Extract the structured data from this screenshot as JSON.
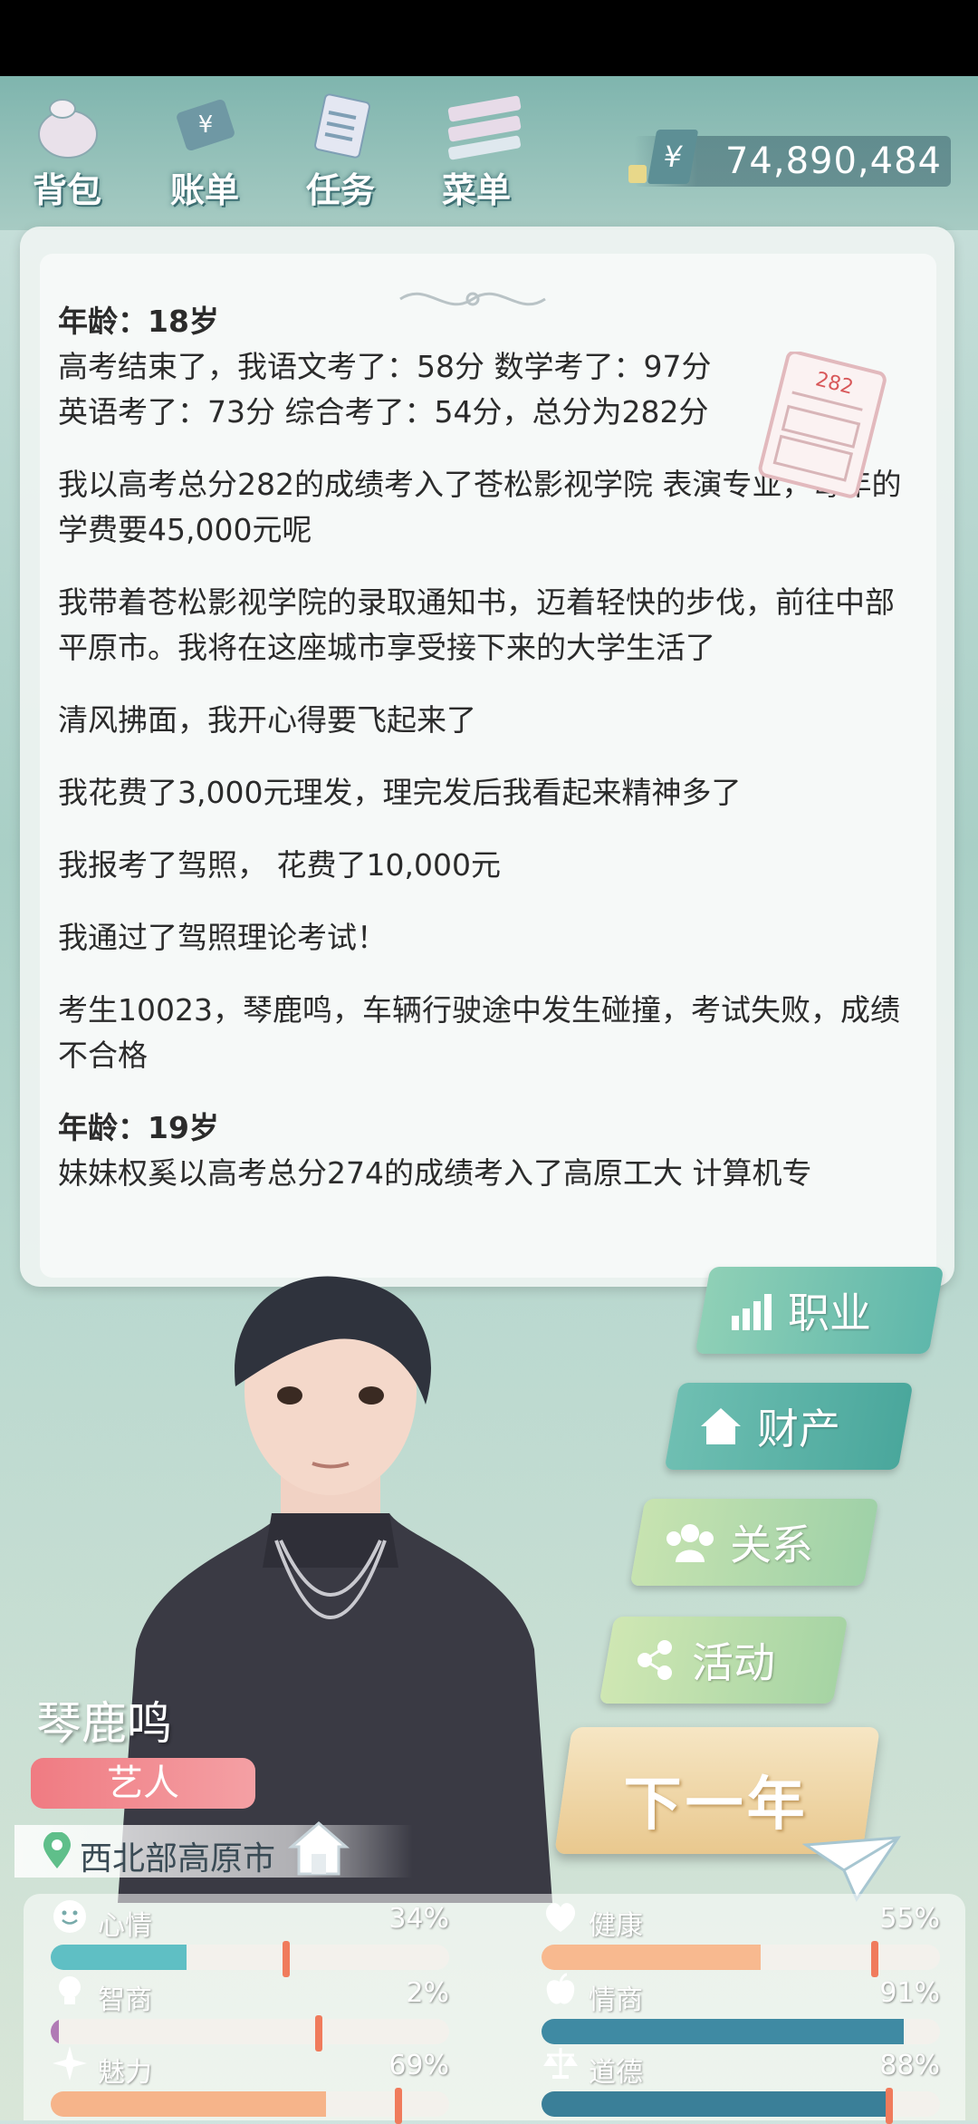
{
  "nav": {
    "items": [
      {
        "label": "背包",
        "icon": "backpack-icon"
      },
      {
        "label": "账单",
        "icon": "bill-icon"
      },
      {
        "label": "任务",
        "icon": "task-icon"
      },
      {
        "label": "菜单",
        "icon": "menu-icon"
      }
    ]
  },
  "money": {
    "symbol": "¥",
    "value": "74,890,484"
  },
  "log": {
    "entries": [
      {
        "age": "年龄：18岁",
        "text": "高考结束了，我语文考了：58分  数学考了：97分  英语考了：73分  综合考了：54分，总分为282分"
      },
      {
        "text": "我以高考总分282的成绩考入了苍松影视学院  表演专业，每年的学费要45,000元呢"
      },
      {
        "text": "我带着苍松影视学院的录取通知书，迈着轻快的步伐，前往中部平原市。我将在这座城市享受接下来的大学生活了"
      },
      {
        "text": "清风拂面，我开心得要飞起来了"
      },
      {
        "text": "我花费了3,000元理发，理完发后我看起来精神多了"
      },
      {
        "text": "我报考了驾照， 花费了10,000元"
      },
      {
        "text": "我通过了驾照理论考试！"
      },
      {
        "text": "考生10023，琴鹿鸣，车辆行驶途中发生碰撞，考试失败，成绩不合格"
      },
      {
        "age": "年龄：19岁",
        "text": "妹妹权奚以高考总分274的成绩考入了高原工大  计算机专"
      }
    ],
    "score_paper": "282"
  },
  "side_menu": {
    "career": "职业",
    "assets": "财产",
    "relations": "关系",
    "activities": "活动"
  },
  "next_year": "下一年",
  "character": {
    "name": "琴鹿鸣",
    "job": "艺人",
    "location": "西北部高原市"
  },
  "stats": {
    "mood": {
      "label": "心情",
      "value": "34%",
      "level": 34
    },
    "health": {
      "label": "健康",
      "value": "55%",
      "level": 55
    },
    "iq": {
      "label": "智商",
      "value": "2%",
      "level": 2
    },
    "eq": {
      "label": "情商",
      "value": "91%",
      "level": 91
    },
    "charm": {
      "label": "魅力",
      "value": "69%",
      "level": 69
    },
    "morality": {
      "label": "道德",
      "value": "88%",
      "level": 88
    }
  },
  "colors": {
    "mood": "#5fbfc4",
    "health": "#f8b98f",
    "iq": "#b07ab5",
    "eq": "#3f8aa3",
    "charm": "#f6b48a",
    "morality": "#3a7f98"
  }
}
